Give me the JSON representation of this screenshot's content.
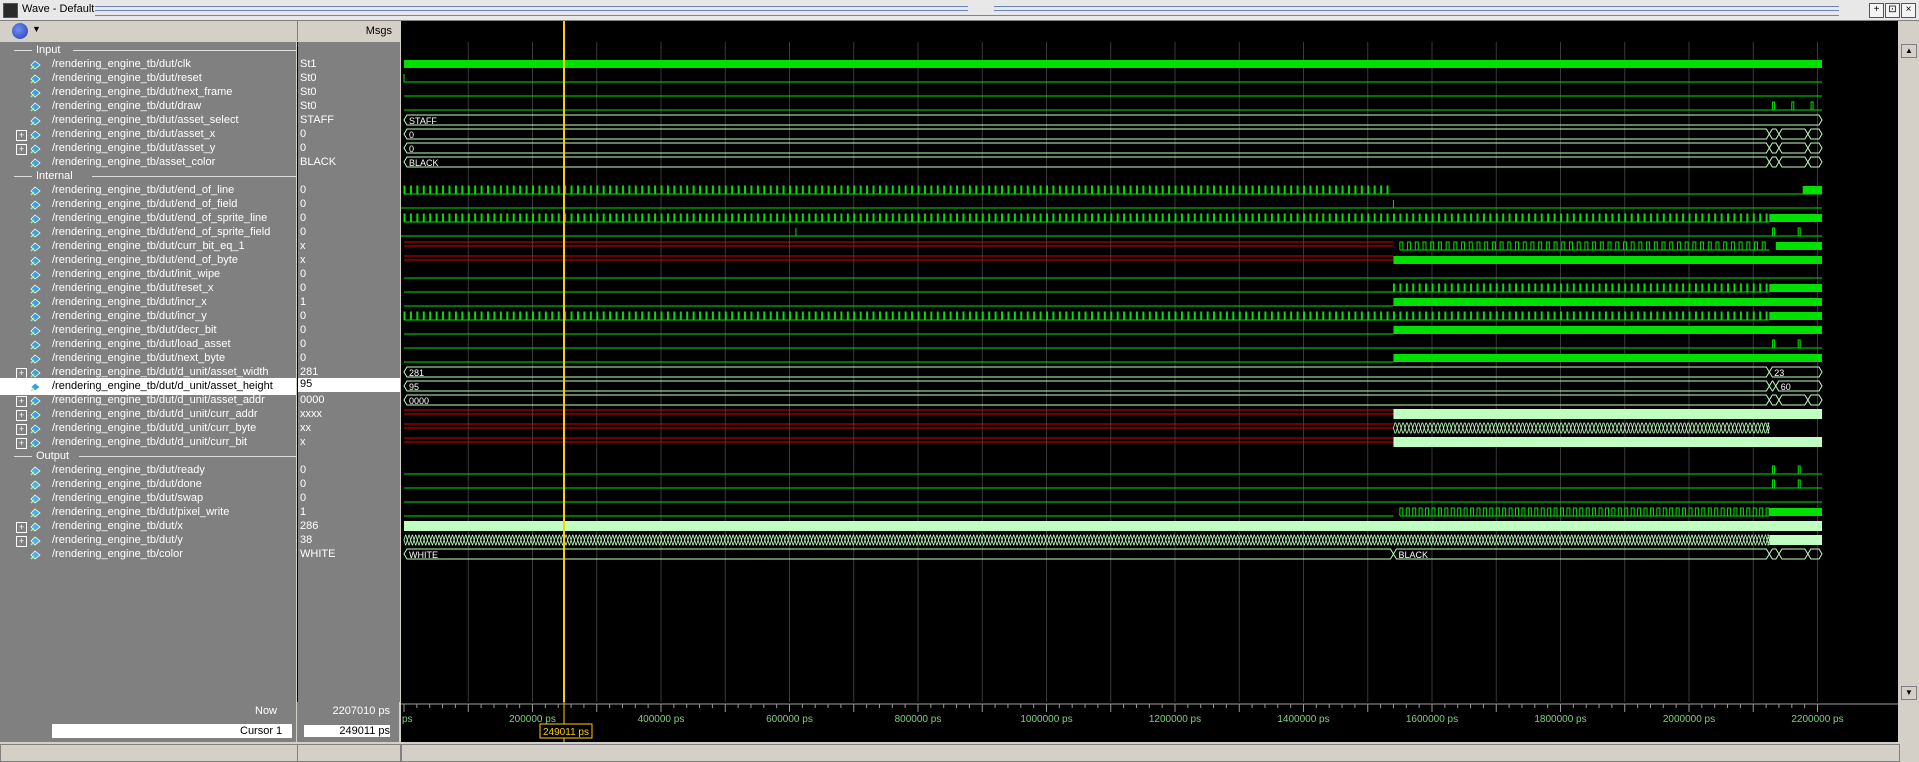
{
  "window": {
    "title": "Wave - Default"
  },
  "header": {
    "msgs": "Msgs"
  },
  "groups": {
    "input": "Input",
    "internal": "Internal",
    "output": "Output"
  },
  "signals": [
    {
      "name": "/rendering_engine_tb/dut/clk",
      "value": "St1"
    },
    {
      "name": "/rendering_engine_tb/dut/reset",
      "value": "St0"
    },
    {
      "name": "/rendering_engine_tb/dut/next_frame",
      "value": "St0"
    },
    {
      "name": "/rendering_engine_tb/dut/draw",
      "value": "St0"
    },
    {
      "name": "/rendering_engine_tb/dut/asset_select",
      "value": "STAFF"
    },
    {
      "name": "/rendering_engine_tb/dut/asset_x",
      "value": "0"
    },
    {
      "name": "/rendering_engine_tb/dut/asset_y",
      "value": "0"
    },
    {
      "name": "/rendering_engine_tb/asset_color",
      "value": "BLACK"
    },
    {
      "name": "/rendering_engine_tb/dut/end_of_line",
      "value": "0"
    },
    {
      "name": "/rendering_engine_tb/dut/end_of_field",
      "value": "0"
    },
    {
      "name": "/rendering_engine_tb/dut/end_of_sprite_line",
      "value": "0"
    },
    {
      "name": "/rendering_engine_tb/dut/end_of_sprite_field",
      "value": "0"
    },
    {
      "name": "/rendering_engine_tb/dut/curr_bit_eq_1",
      "value": "x"
    },
    {
      "name": "/rendering_engine_tb/dut/end_of_byte",
      "value": "x"
    },
    {
      "name": "/rendering_engine_tb/dut/init_wipe",
      "value": "0"
    },
    {
      "name": "/rendering_engine_tb/dut/reset_x",
      "value": "0"
    },
    {
      "name": "/rendering_engine_tb/dut/incr_x",
      "value": "1"
    },
    {
      "name": "/rendering_engine_tb/dut/incr_y",
      "value": "0"
    },
    {
      "name": "/rendering_engine_tb/dut/decr_bit",
      "value": "0"
    },
    {
      "name": "/rendering_engine_tb/dut/load_asset",
      "value": "0"
    },
    {
      "name": "/rendering_engine_tb/dut/next_byte",
      "value": "0"
    },
    {
      "name": "/rendering_engine_tb/dut/d_unit/asset_width",
      "value": "281"
    },
    {
      "name": "/rendering_engine_tb/dut/d_unit/asset_height",
      "value": "95"
    },
    {
      "name": "/rendering_engine_tb/dut/d_unit/asset_addr",
      "value": "0000"
    },
    {
      "name": "/rendering_engine_tb/dut/d_unit/curr_addr",
      "value": "xxxx"
    },
    {
      "name": "/rendering_engine_tb/dut/d_unit/curr_byte",
      "value": "xx"
    },
    {
      "name": "/rendering_engine_tb/dut/d_unit/curr_bit",
      "value": "x"
    },
    {
      "name": "/rendering_engine_tb/dut/ready",
      "value": "0"
    },
    {
      "name": "/rendering_engine_tb/dut/done",
      "value": "0"
    },
    {
      "name": "/rendering_engine_tb/dut/swap",
      "value": "0"
    },
    {
      "name": "/rendering_engine_tb/dut/pixel_write",
      "value": "1"
    },
    {
      "name": "/rendering_engine_tb/dut/x",
      "value": "286"
    },
    {
      "name": "/rendering_engine_tb/dut/y",
      "value": "38"
    },
    {
      "name": "/rendering_engine_tb/color",
      "value": "WHITE"
    }
  ],
  "bus_labels": {
    "asset_select": "STAFF",
    "asset_x": "0",
    "asset_y": "0",
    "asset_color": "BLACK",
    "asset_width_a": "281",
    "asset_width_b": "23",
    "asset_height_a": "95",
    "asset_height_b": "60",
    "asset_addr": "0000",
    "color_a": "WHITE",
    "color_b": "BLACK"
  },
  "status": {
    "now_label": "Now",
    "now_value": "2207010 ps",
    "cursor_label": "Cursor 1",
    "cursor_value": "249011 ps",
    "cursor_flag": "249011 ps"
  },
  "timeline": {
    "start_label": "ps",
    "ticks": [
      "200000 ps",
      "400000 ps",
      "600000 ps",
      "800000 ps",
      "1000000 ps",
      "1200000 ps",
      "1400000 ps",
      "1600000 ps",
      "1800000 ps",
      "2000000 ps",
      "2200000 ps"
    ]
  },
  "colors": {
    "signal": "#00e000",
    "bus": "#bfffbf",
    "undefined": "#e00000",
    "cursor": "#ffd000"
  }
}
